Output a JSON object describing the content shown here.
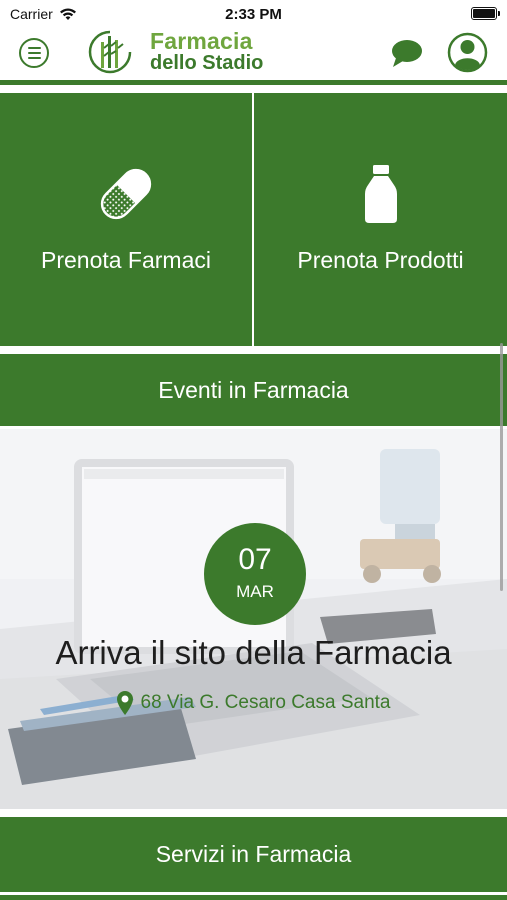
{
  "status_bar": {
    "carrier": "Carrier",
    "time": "2:33 PM",
    "icons": [
      "wifi-icon",
      "battery-icon"
    ]
  },
  "header": {
    "logo_line1": "Farmacia",
    "logo_line2": "dello Stadio",
    "icons": [
      "menu-icon",
      "logo-icon",
      "chat-icon",
      "user-icon"
    ],
    "brand_color": "#3c7a2c",
    "brand_light_color": "#6fa63e"
  },
  "tiles": [
    {
      "label": "Prenota Farmaci",
      "icon": "capsule-icon"
    },
    {
      "label": "Prenota Prodotti",
      "icon": "bottle-icon"
    }
  ],
  "sections": {
    "eventi": "Eventi in Farmacia",
    "servizi": "Servizi in Farmacia"
  },
  "event": {
    "day": "07",
    "month": "MAR",
    "title": "Arriva il sito della Farmacia",
    "address": "68 Via G. Cesaro Casa Santa",
    "address_icon": "location-pin-icon"
  }
}
